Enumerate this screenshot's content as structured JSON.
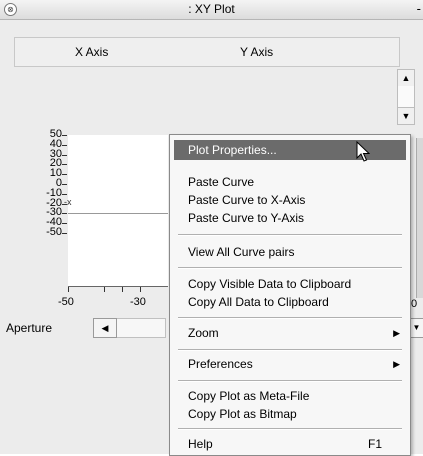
{
  "window": {
    "title": ": XY Plot",
    "minimize_glyph": "-",
    "app_icon": "target-icon",
    "app_icon_glyph": "⊗"
  },
  "table": {
    "columns": [
      "X Axis",
      "Y Axis"
    ]
  },
  "plot": {
    "y_ticks": [
      "50",
      "40",
      "30",
      "20",
      "10",
      "0",
      "-10",
      "-20",
      "-30",
      "-40",
      "-50"
    ],
    "x_ticks": [
      "-50",
      "-30"
    ],
    "curve_marker": "-x",
    "right_tick": "0"
  },
  "aperture": {
    "label": "Aperture"
  },
  "context_menu": {
    "items": [
      {
        "label": "Plot Properties...",
        "highlighted": true
      },
      {
        "label": "Paste Curve"
      },
      {
        "label": "Paste Curve to X-Axis"
      },
      {
        "label": "Paste Curve to Y-Axis"
      },
      {
        "label": "View All Curve pairs"
      },
      {
        "label": "Copy Visible Data to Clipboard"
      },
      {
        "label": "Copy All Data to Clipboard"
      },
      {
        "label": "Zoom",
        "submenu": true
      },
      {
        "label": "Preferences",
        "submenu": true
      },
      {
        "label": "Copy Plot as Meta-File"
      },
      {
        "label": "Copy Plot as Bitmap"
      },
      {
        "label": "Help",
        "shortcut": "F1"
      }
    ]
  },
  "glyphs": {
    "up": "▲",
    "down": "▼",
    "left": "◀",
    "submenu": "▶"
  },
  "colors": {
    "menu_highlight": "#6b6b6b",
    "panel": "#ececec"
  }
}
